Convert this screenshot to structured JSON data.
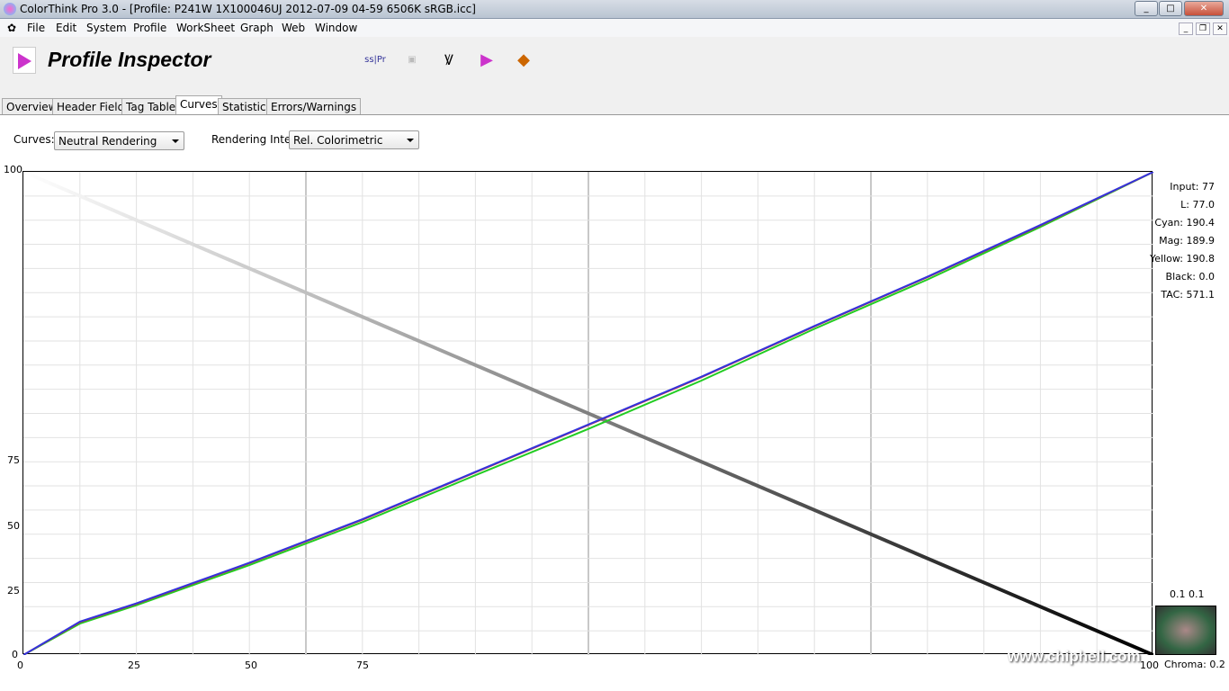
{
  "window": {
    "title": "ColorThink Pro 3.0 - [Profile: P241W 1X100046UJ 2012-07-09 04-59 6506K sRGB.icc]"
  },
  "menu": [
    "File",
    "Edit",
    "System",
    "Profile",
    "WorkSheet",
    "Graph",
    "Web",
    "Window"
  ],
  "header": {
    "title": "Profile Inspector",
    "toolbar_icons": [
      "gamut-icon",
      "convert-icon",
      "profile-check-icon",
      "gamut-2d-icon",
      "gamut-3d-icon"
    ]
  },
  "tabs": [
    "Overview",
    "Header Fields",
    "Tag Table",
    "Curves",
    "Statistics",
    "Errors/Warnings"
  ],
  "active_tab": "Curves",
  "controls": {
    "curves_label": "Curves:",
    "curves_value": "Neutral Rendering",
    "intent_label": "Rendering Intent:",
    "intent_value": "Rel. Colorimetric"
  },
  "readout": [
    {
      "label": "Input:",
      "value": "77"
    },
    {
      "label": "L:",
      "value": "77.0"
    },
    {
      "label": "Cyan:",
      "value": "190.4"
    },
    {
      "label": "Mag:",
      "value": "189.9"
    },
    {
      "label": "Yellow:",
      "value": "190.8"
    },
    {
      "label": "Black:",
      "value": "0.0"
    },
    {
      "label": "TAC:",
      "value": "571.1"
    }
  ],
  "chroma": {
    "top": "0.1 0.1",
    "label": "Chroma: 0.2"
  },
  "watermark": "www.chiphell.com",
  "chart_data": {
    "type": "line",
    "x_ticks": [
      "0",
      "25",
      "50",
      "75",
      "100"
    ],
    "y_ticks": [
      "100",
      "75",
      "50",
      "25",
      "0"
    ],
    "xlim": [
      0,
      100
    ],
    "ylim": [
      0,
      100
    ],
    "grid": true,
    "series": [
      {
        "color": "#808080",
        "x": [
          0,
          100
        ],
        "y": [
          100,
          0
        ]
      },
      {
        "color": "#22cc22",
        "x": [
          0,
          5,
          10,
          20,
          30,
          40,
          50,
          60,
          70,
          80,
          90,
          100
        ],
        "y": [
          0,
          6.5,
          10.3,
          18.6,
          27.5,
          37.2,
          46.8,
          56.8,
          67.5,
          77.7,
          88.6,
          100
        ]
      },
      {
        "color": "#cc3333",
        "x": [
          0,
          5,
          10,
          20,
          30,
          40,
          50,
          60,
          70,
          80,
          90,
          100
        ],
        "y": [
          0,
          6.8,
          10.6,
          19.0,
          28.0,
          37.8,
          47.6,
          57.5,
          68.0,
          78.2,
          88.9,
          100
        ]
      },
      {
        "color": "#3333dd",
        "x": [
          0,
          5,
          10,
          20,
          30,
          40,
          50,
          60,
          70,
          80,
          90,
          100
        ],
        "y": [
          0,
          6.9,
          10.7,
          19.1,
          28.1,
          37.9,
          47.7,
          57.6,
          68.1,
          78.3,
          89.0,
          100
        ]
      }
    ]
  }
}
